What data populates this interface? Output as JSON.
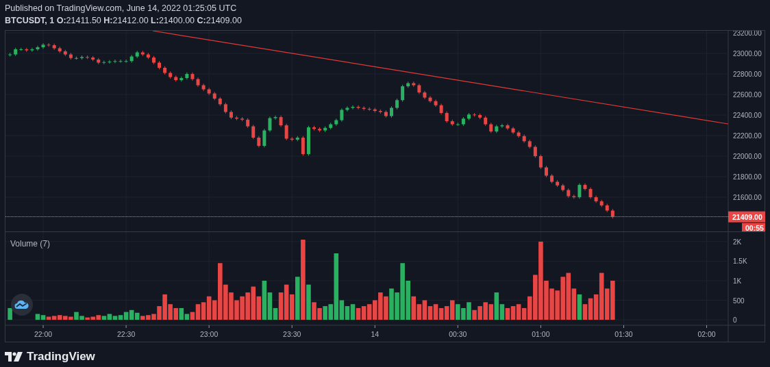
{
  "header": {
    "published": "Published on TradingView.com, June 14, 2022 01:25:05 UTC",
    "legend": "**BTCUSDT, 1** **O:**21411.50 **H:**21412.00 **L:**21400.00 **C:**21409.00"
  },
  "price_chart": {
    "chart_data": {
      "type": "candlestick",
      "grid": true,
      "ylim": [
        21267,
        23220
      ],
      "categories": [
        null,
        null,
        null,
        null,
        null,
        null,
        null,
        null,
        null,
        null,
        null,
        null,
        null,
        null,
        null,
        null,
        null,
        null,
        null,
        null,
        null,
        null,
        null,
        null,
        null,
        null,
        null,
        null,
        null,
        null,
        null,
        null,
        null,
        null,
        null,
        null,
        null,
        null,
        null,
        null,
        null,
        null,
        null,
        null,
        null,
        null,
        null,
        null,
        null,
        null,
        null,
        null,
        null,
        null,
        null,
        null,
        null,
        null,
        null,
        null,
        null,
        null,
        null,
        null,
        null,
        null,
        null,
        null,
        null,
        null,
        null,
        null,
        null,
        null,
        null,
        null,
        null,
        null,
        null,
        null,
        null,
        null,
        null,
        null,
        null,
        null,
        null,
        null,
        null,
        null,
        null,
        null,
        null,
        null,
        null,
        null,
        null,
        null,
        null,
        null,
        null,
        null,
        null,
        null,
        null,
        null,
        null,
        null,
        null,
        null,
        null,
        null,
        null,
        null,
        null,
        null,
        null,
        null,
        null,
        null,
        null,
        null,
        null,
        null,
        null,
        null,
        null,
        null
      ],
      "yticks": [
        {
          "value": 21600,
          "label": "21600.00"
        },
        {
          "value": 21800,
          "label": "21800.00"
        },
        {
          "value": 22000,
          "label": "22000.00"
        },
        {
          "value": 22200,
          "label": "22200.00"
        },
        {
          "value": 22400,
          "label": "22400.00"
        },
        {
          "value": 22600,
          "label": "22600.00"
        },
        {
          "value": 22800,
          "label": "22800.00"
        },
        {
          "value": 23000,
          "label": "23000.00"
        },
        {
          "value": 23200,
          "label": "23200.00"
        }
      ],
      "ohlc": [
        [
          22985,
          23005,
          22970,
          22990
        ],
        [
          22990,
          23055,
          22975,
          23040
        ],
        [
          23040,
          23055,
          23025,
          23040
        ],
        [
          23040,
          23055,
          23015,
          23030
        ],
        [
          23030,
          23055,
          23015,
          23040
        ],
        [
          23040,
          23075,
          23025,
          23060
        ],
        [
          23060,
          23100,
          23045,
          23085
        ],
        [
          23085,
          23100,
          23065,
          23080
        ],
        [
          23080,
          23095,
          23035,
          23050
        ],
        [
          23050,
          23065,
          23005,
          23020
        ],
        [
          23020,
          23035,
          22975,
          22990
        ],
        [
          22990,
          23005,
          22940,
          22955
        ],
        [
          22955,
          22970,
          22940,
          22955
        ],
        [
          22955,
          22980,
          22940,
          22965
        ],
        [
          22965,
          22980,
          22945,
          22960
        ],
        [
          22960,
          22975,
          22925,
          22940
        ],
        [
          22940,
          22955,
          22895,
          22910
        ],
        [
          22910,
          22930,
          22895,
          22915
        ],
        [
          22915,
          22935,
          22900,
          22920
        ],
        [
          22920,
          22940,
          22905,
          22925
        ],
        [
          22925,
          22940,
          22910,
          22925
        ],
        [
          22925,
          22940,
          22910,
          22925
        ],
        [
          22925,
          22985,
          22910,
          22970
        ],
        [
          22970,
          23025,
          22955,
          23010
        ],
        [
          23010,
          23025,
          22975,
          22990
        ],
        [
          22990,
          23005,
          22945,
          22960
        ],
        [
          22960,
          22975,
          22895,
          22910
        ],
        [
          22910,
          22925,
          22845,
          22860
        ],
        [
          22860,
          22875,
          22795,
          22810
        ],
        [
          22810,
          22825,
          22755,
          22770
        ],
        [
          22770,
          22785,
          22725,
          22740
        ],
        [
          22740,
          22775,
          22725,
          22760
        ],
        [
          22760,
          22815,
          22745,
          22800
        ],
        [
          22800,
          22815,
          22735,
          22750
        ],
        [
          22750,
          22765,
          22675,
          22690
        ],
        [
          22690,
          22705,
          22635,
          22650
        ],
        [
          22650,
          22665,
          22595,
          22610
        ],
        [
          22610,
          22625,
          22545,
          22560
        ],
        [
          22560,
          22575,
          22490,
          22505
        ],
        [
          22505,
          22520,
          22415,
          22430
        ],
        [
          22430,
          22445,
          22360,
          22375
        ],
        [
          22375,
          22390,
          22350,
          22365
        ],
        [
          22365,
          22380,
          22340,
          22355
        ],
        [
          22355,
          22370,
          22275,
          22290
        ],
        [
          22290,
          22305,
          22165,
          22180
        ],
        [
          22180,
          22195,
          22085,
          22100
        ],
        [
          22100,
          22265,
          22085,
          22250
        ],
        [
          22250,
          22385,
          22235,
          22370
        ],
        [
          22370,
          22395,
          22355,
          22380
        ],
        [
          22380,
          22395,
          22285,
          22300
        ],
        [
          22300,
          22315,
          22155,
          22170
        ],
        [
          22170,
          22185,
          22145,
          22160
        ],
        [
          22160,
          22195,
          22145,
          22180
        ],
        [
          22180,
          22195,
          22005,
          22020
        ],
        [
          22020,
          22295,
          22005,
          22280
        ],
        [
          22280,
          22295,
          22250,
          22265
        ],
        [
          22265,
          22280,
          22235,
          22250
        ],
        [
          22250,
          22290,
          22235,
          22275
        ],
        [
          22275,
          22325,
          22260,
          22310
        ],
        [
          22310,
          22365,
          22295,
          22350
        ],
        [
          22350,
          22465,
          22335,
          22450
        ],
        [
          22450,
          22485,
          22435,
          22470
        ],
        [
          22470,
          22495,
          22455,
          22480
        ],
        [
          22480,
          22495,
          22455,
          22470
        ],
        [
          22470,
          22485,
          22445,
          22460
        ],
        [
          22460,
          22475,
          22440,
          22455
        ],
        [
          22455,
          22470,
          22425,
          22440
        ],
        [
          22440,
          22455,
          22415,
          22430
        ],
        [
          22430,
          22445,
          22375,
          22390
        ],
        [
          22390,
          22485,
          22375,
          22470
        ],
        [
          22470,
          22560,
          22455,
          22545
        ],
        [
          22545,
          22695,
          22530,
          22680
        ],
        [
          22680,
          22725,
          22665,
          22710
        ],
        [
          22710,
          22725,
          22675,
          22690
        ],
        [
          22690,
          22705,
          22605,
          22620
        ],
        [
          22620,
          22635,
          22555,
          22570
        ],
        [
          22570,
          22585,
          22520,
          22535
        ],
        [
          22535,
          22550,
          22480,
          22495
        ],
        [
          22495,
          22510,
          22405,
          22420
        ],
        [
          22420,
          22435,
          22325,
          22340
        ],
        [
          22340,
          22355,
          22295,
          22310
        ],
        [
          22310,
          22325,
          22295,
          22310
        ],
        [
          22310,
          22380,
          22295,
          22365
        ],
        [
          22365,
          22420,
          22350,
          22405
        ],
        [
          22405,
          22420,
          22385,
          22400
        ],
        [
          22400,
          22415,
          22360,
          22375
        ],
        [
          22375,
          22390,
          22295,
          22310
        ],
        [
          22310,
          22325,
          22225,
          22240
        ],
        [
          22240,
          22305,
          22225,
          22290
        ],
        [
          22290,
          22315,
          22275,
          22300
        ],
        [
          22300,
          22315,
          22255,
          22270
        ],
        [
          22270,
          22285,
          22215,
          22230
        ],
        [
          22230,
          22245,
          22180,
          22195
        ],
        [
          22195,
          22210,
          22130,
          22145
        ],
        [
          22145,
          22160,
          22075,
          22090
        ],
        [
          22090,
          22105,
          21985,
          22000
        ],
        [
          22000,
          22015,
          21875,
          21890
        ],
        [
          21890,
          21905,
          21795,
          21810
        ],
        [
          21810,
          21825,
          21735,
          21750
        ],
        [
          21750,
          21765,
          21700,
          21715
        ],
        [
          21715,
          21730,
          21655,
          21670
        ],
        [
          21670,
          21685,
          21595,
          21610
        ],
        [
          21610,
          21625,
          21585,
          21600
        ],
        [
          21600,
          21735,
          21585,
          21720
        ],
        [
          21720,
          21735,
          21665,
          21680
        ],
        [
          21680,
          21695,
          21585,
          21600
        ],
        [
          21600,
          21615,
          21545,
          21560
        ],
        [
          21560,
          21575,
          21505,
          21520
        ],
        [
          21520,
          21535,
          21455,
          21470
        ],
        [
          21470,
          21485,
          21394,
          21409
        ],
        null,
        null,
        null,
        null,
        null,
        null,
        null,
        null,
        null,
        null,
        null,
        null,
        null,
        null,
        null,
        null,
        null,
        null
      ]
    },
    "last_price": {
      "label": "21409.00",
      "countdown": "00:55"
    }
  },
  "volume_chart": {
    "chart_data": {
      "type": "bar",
      "title": "Volume (7)",
      "grid": true,
      "stacked": true,
      "ylim": [
        -139,
        2243
      ],
      "categories": [
        null,
        null,
        null,
        null,
        null,
        null,
        "22:00",
        null,
        null,
        null,
        null,
        null,
        null,
        null,
        null,
        null,
        null,
        null,
        null,
        null,
        null,
        "22:30",
        null,
        null,
        null,
        null,
        null,
        null,
        null,
        null,
        null,
        null,
        null,
        null,
        null,
        null,
        "23:00",
        null,
        null,
        null,
        null,
        null,
        null,
        null,
        null,
        null,
        null,
        null,
        null,
        null,
        null,
        "23:30",
        null,
        null,
        null,
        null,
        null,
        null,
        null,
        null,
        null,
        null,
        null,
        null,
        null,
        null,
        "14",
        null,
        null,
        null,
        null,
        null,
        null,
        null,
        null,
        null,
        null,
        null,
        null,
        null,
        null,
        "00:30",
        null,
        null,
        null,
        null,
        null,
        null,
        null,
        null,
        null,
        null,
        null,
        null,
        null,
        null,
        "01:00",
        null,
        null,
        null,
        null,
        null,
        null,
        null,
        null,
        null,
        null,
        null,
        null,
        null,
        null,
        "01:30",
        null,
        null,
        null,
        null,
        null,
        null,
        null,
        null,
        null,
        null,
        null,
        null,
        null,
        null,
        "02:00",
        null
      ],
      "yticks": [
        {
          "value": 0,
          "label": "0"
        },
        {
          "value": 500,
          "label": "500"
        },
        {
          "value": 1000,
          "label": "1K"
        },
        {
          "value": 1500,
          "label": "1.5K"
        },
        {
          "value": 2000,
          "label": "2K"
        }
      ],
      "series": [
        {
          "color": "#2ab061",
          "values": [
            300,
            null,
            null,
            null,
            null,
            150,
            120,
            null,
            null,
            null,
            null,
            null,
            200,
            100,
            null,
            null,
            null,
            100,
            150,
            100,
            120,
            200,
            250,
            180,
            null,
            null,
            null,
            null,
            null,
            null,
            null,
            300,
            150,
            null,
            null,
            null,
            null,
            null,
            null,
            null,
            null,
            null,
            null,
            null,
            null,
            null,
            1000,
            700,
            300,
            null,
            null,
            null,
            1100,
            null,
            900,
            null,
            null,
            350,
            400,
            1700,
            500,
            350,
            400,
            null,
            null,
            null,
            null,
            null,
            null,
            800,
            700,
            1450,
            1000,
            null,
            null,
            null,
            null,
            null,
            null,
            null,
            null,
            400,
            300,
            450,
            null,
            null,
            null,
            null,
            700,
            400,
            null,
            null,
            null,
            null,
            null,
            null,
            null,
            null,
            null,
            null,
            null,
            null,
            null,
            650,
            null,
            null,
            null,
            null,
            null,
            null,
            null,
            null,
            null,
            null,
            null,
            null,
            null,
            null,
            null,
            null,
            null,
            null,
            null,
            null,
            null,
            null,
            null,
            null
          ]
        },
        {
          "color": "#e84545",
          "values": [
            null,
            null,
            null,
            null,
            null,
            null,
            null,
            80,
            100,
            120,
            100,
            80,
            null,
            null,
            60,
            80,
            120,
            null,
            null,
            null,
            null,
            null,
            null,
            null,
            100,
            120,
            150,
            350,
            650,
            400,
            300,
            null,
            null,
            200,
            400,
            450,
            600,
            500,
            1450,
            900,
            700,
            500,
            600,
            700,
            850,
            600,
            null,
            null,
            null,
            700,
            900,
            650,
            null,
            2050,
            null,
            450,
            300,
            null,
            null,
            null,
            null,
            null,
            null,
            300,
            350,
            400,
            500,
            700,
            600,
            null,
            null,
            null,
            null,
            600,
            400,
            500,
            350,
            400,
            300,
            350,
            500,
            null,
            null,
            null,
            250,
            350,
            450,
            400,
            null,
            null,
            300,
            350,
            400,
            300,
            600,
            1150,
            2000,
            1000,
            800,
            750,
            1100,
            1200,
            800,
            null,
            400,
            550,
            650,
            1200,
            800,
            1000,
            null,
            null,
            null,
            null,
            null,
            null,
            null,
            null,
            null,
            null,
            null,
            null,
            null,
            null,
            null,
            null,
            null,
            null
          ]
        }
      ]
    }
  },
  "brand": {
    "name": "TradingView"
  }
}
